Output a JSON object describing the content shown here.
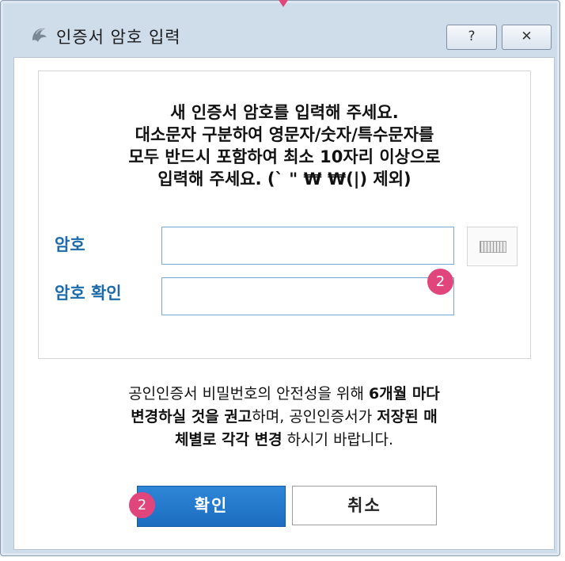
{
  "window": {
    "title": "인증서 암호 입력",
    "help_label": "?",
    "close_label": "✕"
  },
  "instructions": {
    "lines": [
      "새 인증서 암호를 입력해 주세요.",
      "대소문자 구분하여 영문자/숫자/특수문자를",
      "모두 반드시 포함하여 최소 10자리 이상으로",
      "입력해 주세요. (` \" ₩ ₩(|) 제외)"
    ]
  },
  "form": {
    "password_label": "암호",
    "password_value": "",
    "confirm_label": "암호 확인",
    "confirm_value": "",
    "keyboard_icon": "virtual-keyboard-icon"
  },
  "notice": {
    "line1_normal": "공인인증서 비밀번호의 안전성을 위해 ",
    "line1_bold": "6개월 마다",
    "line2_bold": "변경하실 것을 권고",
    "line2_normal": "하며, 공인인증서가 ",
    "line2_bold2": "저장된 매",
    "line3_bold": "체별로 각각 변경",
    "line3_normal": " 하시기 바랍니다."
  },
  "buttons": {
    "ok_label": "확인",
    "cancel_label": "취소"
  },
  "badges": {
    "fields": "2",
    "ok": "2",
    "color": "#e0457b"
  },
  "colors": {
    "label_blue": "#1c6aa8",
    "ok_button": "#1c6dc0",
    "frame": "#cfdcea"
  }
}
